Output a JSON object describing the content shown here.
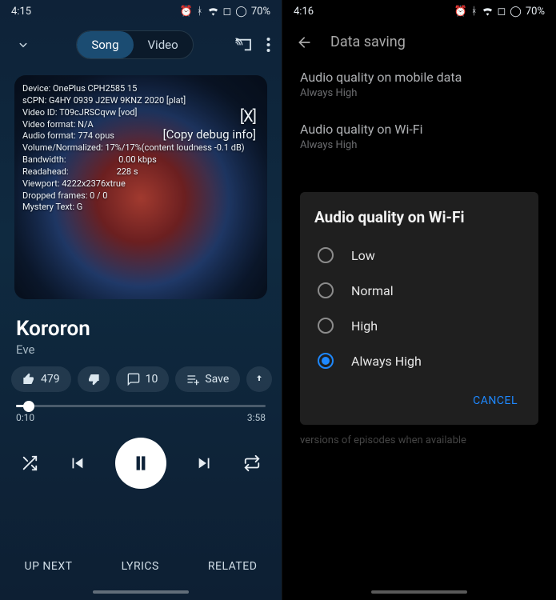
{
  "left": {
    "status": {
      "time": "4:15",
      "battery": "70%"
    },
    "segmented": {
      "song": "Song",
      "video": "Video"
    },
    "debug": {
      "l1": "Device: OnePlus CPH2585 15",
      "l2": "sCPN: G4HY 0939 J2EW 9KNZ 2020 [plat]",
      "l3": "Video ID: T09cJRSCqvw [vod]",
      "l4": "Video format: N/A",
      "l5": "Audio format: 774 opus",
      "l6": "Volume/Normalized: 17%/17%(content loudness -0.1 dB)",
      "l7": "Bandwidth:",
      "l7v": "0.00 kbps",
      "l8": "Readahead:",
      "l8v": "228 s",
      "l9": "Viewport: 4222x2376xtrue",
      "l10": "Dropped frames: 0 / 0",
      "l11": "Mystery Text: G",
      "close": "[X]",
      "copy": "[Copy debug info]"
    },
    "track": {
      "title": "Kororon",
      "artist": "Eve"
    },
    "chips": {
      "likes": "479",
      "comments": "10",
      "save": "Save"
    },
    "seek": {
      "current": "0:10",
      "total": "3:58"
    },
    "tabs": {
      "upnext": "UP NEXT",
      "lyrics": "LYRICS",
      "related": "RELATED"
    }
  },
  "right": {
    "status": {
      "time": "4:16",
      "battery": "70%"
    },
    "header": "Data saving",
    "item1": {
      "lab": "Audio quality on mobile data",
      "sub": "Always High"
    },
    "item2": {
      "lab": "Audio quality on Wi-Fi",
      "sub": "Always High"
    },
    "dialog": {
      "title": "Audio quality on Wi-Fi",
      "opt1": "Low",
      "opt2": "Normal",
      "opt3": "High",
      "opt4": "Always High",
      "cancel": "CANCEL"
    },
    "obscured": "versions of episodes when available"
  }
}
